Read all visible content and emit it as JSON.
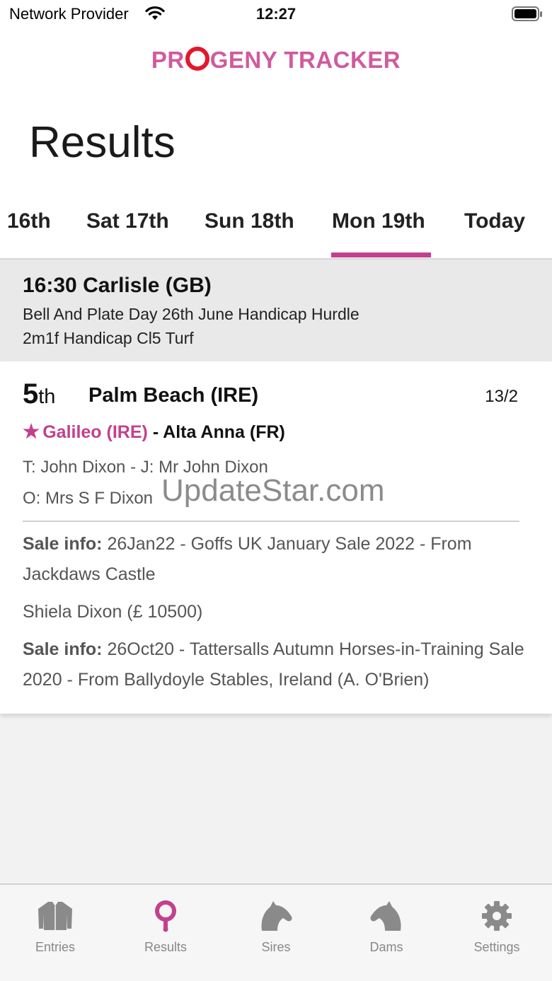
{
  "status_bar": {
    "carrier": "Network Provider",
    "time": "12:27"
  },
  "logo": {
    "part1": "PR",
    "part2": "GENY TRACKER"
  },
  "page_title": "Results",
  "date_tabs": [
    {
      "label": "16th"
    },
    {
      "label": "Sat 17th"
    },
    {
      "label": "Sun 18th"
    },
    {
      "label": "Mon 19th"
    },
    {
      "label": "Today"
    }
  ],
  "active_tab": "Mon 19th",
  "race": {
    "title": "16:30 Carlisle (GB)",
    "name": "Bell And Plate Day 26th June Handicap Hurdle",
    "details": "2m1f Handicap Cl5 Turf"
  },
  "result": {
    "position": "5",
    "position_suffix": "th",
    "horse": "Palm Beach (IRE)",
    "odds": "13/2",
    "sire": "Galileo (IRE)",
    "separator": "-",
    "dam": "Alta Anna (FR)",
    "trainer_jockey": "T: John Dixon - J: Mr John Dixon",
    "owner": "O: Mrs S F Dixon",
    "watermark": "UpdateStar.com",
    "sales": [
      {
        "label": "Sale info:",
        "text": " 26Jan22 - Goffs UK January Sale 2022 - From Jackdaws Castle"
      },
      {
        "label": "",
        "text": "Shiela Dixon (£ 10500)"
      },
      {
        "label": "Sale info:",
        "text": " 26Oct20 - Tattersalls Autumn Horses-in-Training Sale 2020 - From Ballydoyle Stables, Ireland (A. O'Brien)"
      }
    ]
  },
  "tab_bar": [
    {
      "label": "Entries",
      "icon": "jacket-icon"
    },
    {
      "label": "Results",
      "icon": "location-pin-icon"
    },
    {
      "label": "Sires",
      "icon": "horse-head-icon"
    },
    {
      "label": "Dams",
      "icon": "horse-head-icon"
    },
    {
      "label": "Settings",
      "icon": "gear-icon"
    }
  ],
  "colors": {
    "accent": "#c2418c",
    "logo_pink": "#d05b9e",
    "logo_ring": "#e5172b",
    "icon_gray": "#8a8a8a"
  }
}
